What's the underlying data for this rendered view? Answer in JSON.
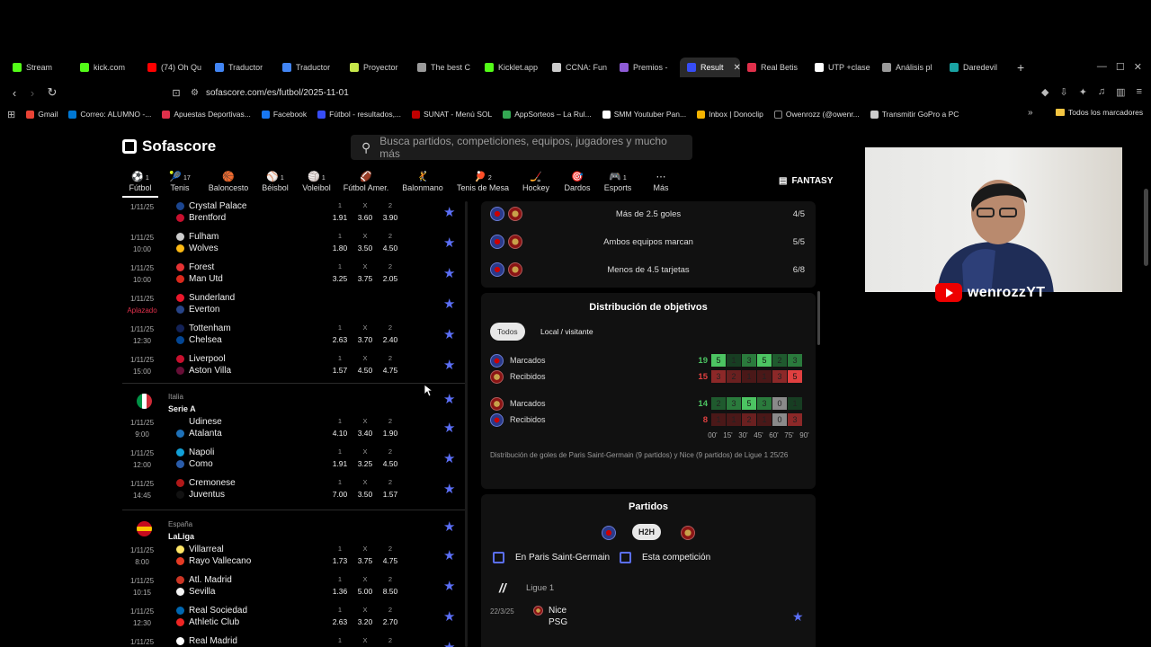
{
  "browser": {
    "tabs": [
      {
        "label": "Stream",
        "color": "#53fc18"
      },
      {
        "label": "kick.com",
        "color": "#53fc18"
      },
      {
        "label": "(74) Oh Qu",
        "color": "#ff0000"
      },
      {
        "label": "Traductor",
        "color": "#4285f4"
      },
      {
        "label": "Traductor",
        "color": "#4285f4"
      },
      {
        "label": "Proyector",
        "color": "#c6e84a"
      },
      {
        "label": "The best C",
        "color": "#9a9a9a"
      },
      {
        "label": "Kicklet.app",
        "color": "#53fc18"
      },
      {
        "label": "CCNA: Fun",
        "color": "#cccccc"
      },
      {
        "label": "Premios -",
        "color": "#8e5bd6"
      },
      {
        "label": "Result",
        "color": "#374df5",
        "active": true
      },
      {
        "label": "Real Betis",
        "color": "#e0304b"
      },
      {
        "label": "UTP +clase",
        "color": "#ffffff"
      },
      {
        "label": "Análisis pl",
        "color": "#9a9a9a"
      },
      {
        "label": "Daredevil",
        "color": "#1aa3a3"
      }
    ],
    "url": "sofascore.com/es/futbol/2025-11-01",
    "bookmarks": [
      {
        "label": "Gmail",
        "color": "#ea4335"
      },
      {
        "label": "Correo: ALUMNO -...",
        "color": "#0078d4"
      },
      {
        "label": "Apuestas Deportivas...",
        "color": "#e0304b"
      },
      {
        "label": "Facebook",
        "color": "#1877f2"
      },
      {
        "label": "Fútbol - resultados,...",
        "color": "#374df5"
      },
      {
        "label": "SUNAT - Menú SOL",
        "color": "#c00000"
      },
      {
        "label": "AppSorteos – La Rul...",
        "color": "#34a853"
      },
      {
        "label": "SMM Youtuber Pan...",
        "color": "#ffffff"
      },
      {
        "label": "Inbox | Donoclip",
        "color": "#f4b400"
      },
      {
        "label": "Owenrozz (@owenr...",
        "color": "#000000"
      },
      {
        "label": "Transmitir GoPro a PC",
        "color": "#cccccc"
      }
    ],
    "all_bookmarks_label": "Todos los marcadores"
  },
  "site": {
    "logo": "Sofascore",
    "search_placeholder": "Busca partidos, competiciones, equipos, jugadores y mucho más",
    "sports": [
      {
        "label": "Fútbol",
        "count": "1",
        "icon": "⚽",
        "active": true
      },
      {
        "label": "Tenis",
        "count": "17",
        "icon": "🎾"
      },
      {
        "label": "Baloncesto",
        "count": "",
        "icon": "🏀"
      },
      {
        "label": "Béisbol",
        "count": "1",
        "icon": "⚾"
      },
      {
        "label": "Voleibol",
        "count": "1",
        "icon": "🏐"
      },
      {
        "label": "Fútbol Amer.",
        "count": "",
        "icon": "🏈"
      },
      {
        "label": "Balonmano",
        "count": "",
        "icon": "🤾"
      },
      {
        "label": "Tenis de Mesa",
        "count": "2",
        "icon": "🏓"
      },
      {
        "label": "Hockey",
        "count": "",
        "icon": "🏒"
      },
      {
        "label": "Dardos",
        "count": "",
        "icon": "🎯"
      },
      {
        "label": "Esports",
        "count": "1",
        "icon": "🎮"
      },
      {
        "label": "Más",
        "count": "",
        "icon": "⋯"
      }
    ],
    "fantasy": "FANTASY"
  },
  "matches": {
    "odds_headers": [
      "1",
      "X",
      "2"
    ],
    "england": [
      {
        "date": "1/11/25",
        "time": "",
        "home": "Crystal Palace",
        "away": "Brentford",
        "odds": [
          "1.91",
          "3.60",
          "3.90"
        ]
      },
      {
        "date": "1/11/25",
        "time": "10:00",
        "home": "Fulham",
        "away": "Wolves",
        "odds": [
          "1.80",
          "3.50",
          "4.50"
        ]
      },
      {
        "date": "1/11/25",
        "time": "10:00",
        "home": "Forest",
        "away": "Man Utd",
        "odds": [
          "3.25",
          "3.75",
          "2.05"
        ]
      },
      {
        "date": "1/11/25",
        "time": "Aplazado",
        "home": "Sunderland",
        "away": "Everton",
        "odds": []
      },
      {
        "date": "1/11/25",
        "time": "12:30",
        "home": "Tottenham",
        "away": "Chelsea",
        "odds": [
          "2.63",
          "3.70",
          "2.40"
        ]
      },
      {
        "date": "1/11/25",
        "time": "15:00",
        "home": "Liverpool",
        "away": "Aston Villa",
        "odds": [
          "1.57",
          "4.50",
          "4.75"
        ]
      }
    ],
    "italy": {
      "country": "Italia",
      "league": "Serie A",
      "rows": [
        {
          "date": "1/11/25",
          "time": "9:00",
          "home": "Udinese",
          "away": "Atalanta",
          "odds": [
            "4.10",
            "3.40",
            "1.90"
          ]
        },
        {
          "date": "1/11/25",
          "time": "12:00",
          "home": "Napoli",
          "away": "Como",
          "odds": [
            "1.91",
            "3.25",
            "4.50"
          ]
        },
        {
          "date": "1/11/25",
          "time": "14:45",
          "home": "Cremonese",
          "away": "Juventus",
          "odds": [
            "7.00",
            "3.50",
            "1.57"
          ]
        }
      ]
    },
    "spain": {
      "country": "España",
      "league": "LaLiga",
      "rows": [
        {
          "date": "1/11/25",
          "time": "8:00",
          "home": "Villarreal",
          "away": "Rayo Vallecano",
          "odds": [
            "1.73",
            "3.75",
            "4.75"
          ]
        },
        {
          "date": "1/11/25",
          "time": "10:15",
          "home": "Atl. Madrid",
          "away": "Sevilla",
          "odds": [
            "1.36",
            "5.00",
            "8.50"
          ]
        },
        {
          "date": "1/11/25",
          "time": "12:30",
          "home": "Real Sociedad",
          "away": "Athletic Club",
          "odds": [
            "2.63",
            "3.20",
            "2.70"
          ]
        },
        {
          "date": "1/11/25",
          "time": "",
          "home": "Real Madrid",
          "away": "",
          "odds": []
        }
      ]
    }
  },
  "detail": {
    "trends": [
      {
        "label": "Más de 2.5 goles",
        "value": "4/5"
      },
      {
        "label": "Ambos equipos marcan",
        "value": "5/5"
      },
      {
        "label": "Menos de 4.5 tarjetas",
        "value": "6/8"
      }
    ],
    "goal_dist": {
      "title": "Distribución de objetivos",
      "tab_all": "Todos",
      "tab_home_away": "Local / visitante",
      "team1": {
        "scored_label": "Marcados",
        "scored_total": "19",
        "scored": [
          "5",
          "1",
          "3",
          "5",
          "2",
          "3"
        ],
        "conceded_label": "Recibidos",
        "conceded_total": "15",
        "conceded": [
          "3",
          "2",
          "1",
          "1",
          "3",
          "5"
        ]
      },
      "team2": {
        "scored_label": "Marcados",
        "scored_total": "14",
        "scored": [
          "2",
          "3",
          "5",
          "3",
          "0",
          "1"
        ],
        "conceded_label": "Recibidos",
        "conceded_total": "8",
        "conceded": [
          "1",
          "1",
          "2",
          "1",
          "0",
          "3"
        ]
      },
      "minutes": [
        "00'",
        "15'",
        "30'",
        "45'",
        "60'",
        "75'",
        "90'"
      ],
      "note": "Distribución de goles de Paris Saint-Germain (9 partidos) y Nice (9 partidos) de Ligue 1 25/26"
    },
    "partidos": {
      "title": "Partidos",
      "h2h": "H2H",
      "filter1": "En Paris Saint-Germain",
      "filter2": "Esta competición",
      "league": "Ligue 1",
      "first_date": "22/3/25",
      "first_home": "Nice",
      "first_away": "PSG"
    }
  },
  "stream": {
    "channel": "OwenrozzYT",
    "visible_text": "wenrozzYT"
  }
}
